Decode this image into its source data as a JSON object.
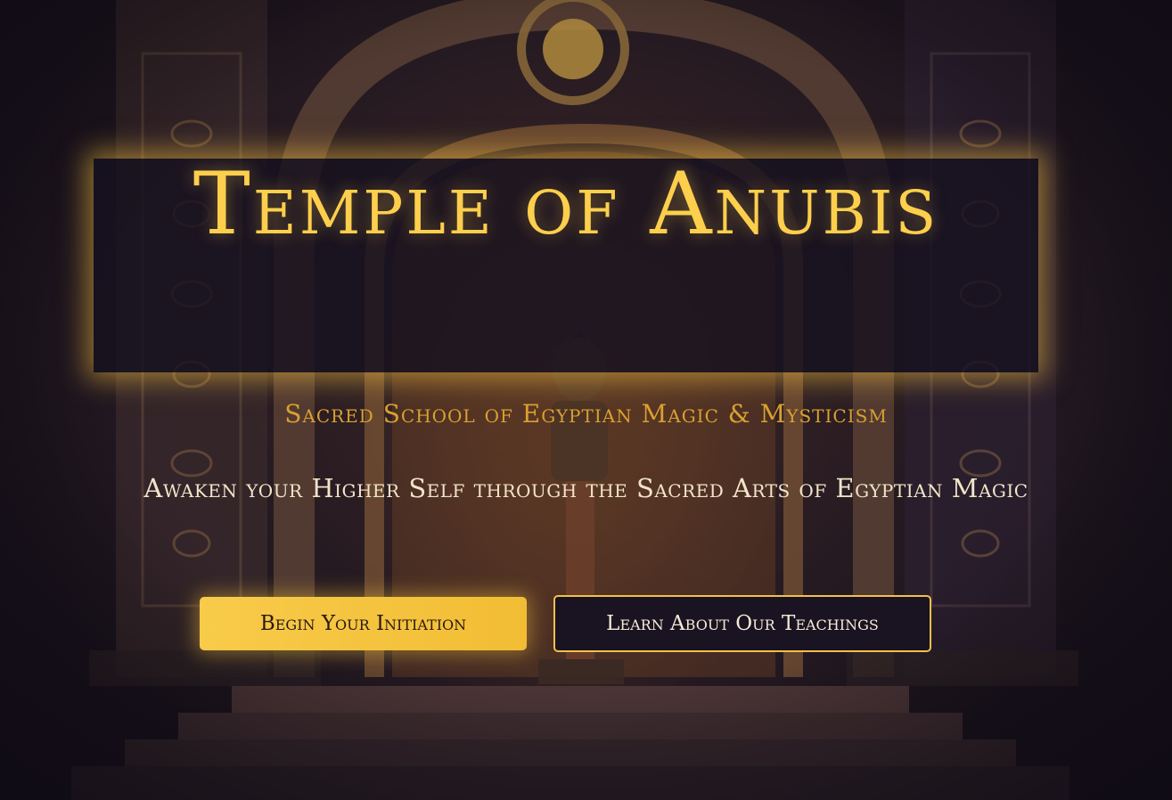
{
  "hero": {
    "title": "Temple of Anubis",
    "subtitle": "Sacred School of Egyptian Magic & Mysticism",
    "tagline": "Awaken your Higher Self through the Sacred Arts of Egyptian Magic"
  },
  "buttons": {
    "primary_label": "Begin Your Initiation",
    "secondary_label": "Learn About Our Teachings"
  },
  "colors": {
    "gold": "#fdcf4c",
    "subtitle_gold": "#d9a030",
    "cream": "#f1e4c8",
    "deep_purple": "#1a1321"
  },
  "background": {
    "icon": "egyptian-temple-anubis-statue-illustration"
  }
}
